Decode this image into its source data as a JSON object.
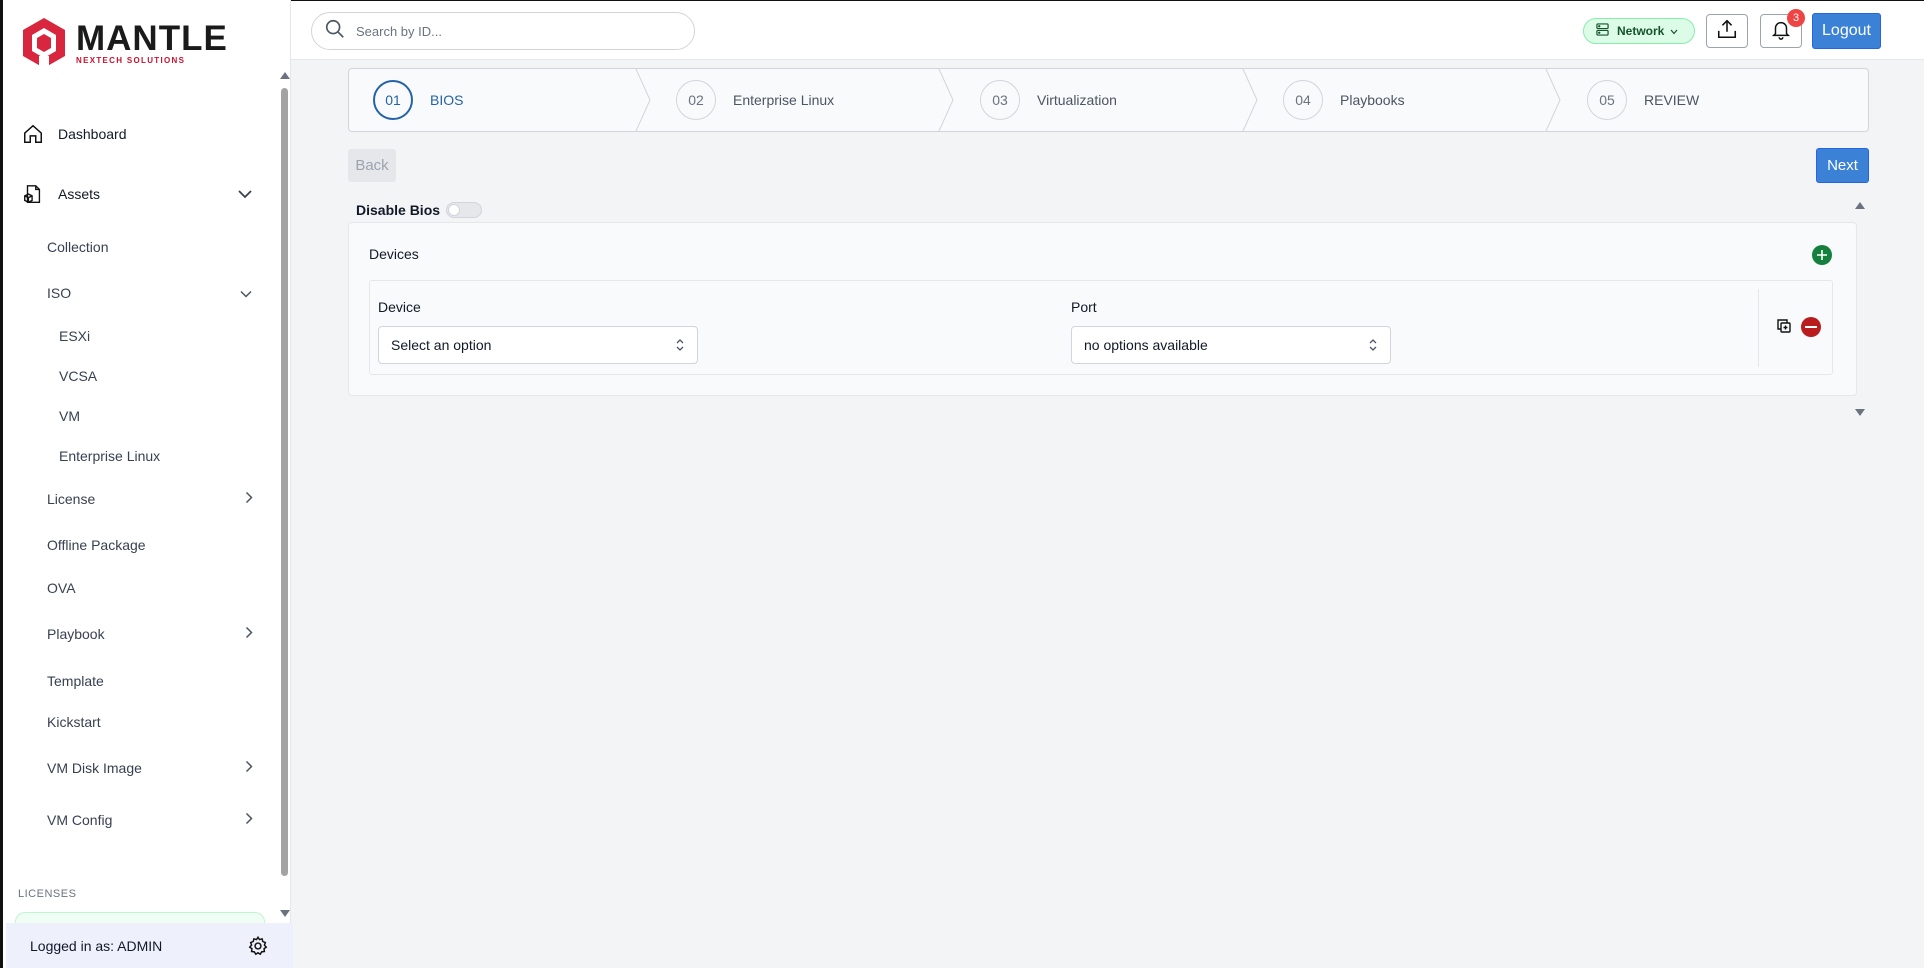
{
  "brand": {
    "title": "MANTLE",
    "subtitle": "NEXTECH SOLUTIONS",
    "red": "#d7263d"
  },
  "sidebar": {
    "dashboard": "Dashboard",
    "assets": "Assets",
    "collection": "Collection",
    "iso": "ISO",
    "iso_items": [
      "ESXi",
      "VCSA",
      "VM",
      "Enterprise Linux"
    ],
    "license": "License",
    "offline_package": "Offline Package",
    "ova": "OVA",
    "playbook": "Playbook",
    "template": "Template",
    "kickstart": "Kickstart",
    "vm_disk_image": "VM Disk Image",
    "vm_config": "VM Config",
    "licenses_label": "LICENSES",
    "logged_in": "Logged in as: ADMIN"
  },
  "header": {
    "search_placeholder": "Search by ID...",
    "network_label": "Network",
    "notifications_count": "3",
    "logout_label": "Logout"
  },
  "stepper": {
    "steps": [
      {
        "num": "01",
        "label": "BIOS",
        "active": true
      },
      {
        "num": "02",
        "label": "Enterprise Linux",
        "active": false
      },
      {
        "num": "03",
        "label": "Virtualization",
        "active": false
      },
      {
        "num": "04",
        "label": "Playbooks",
        "active": false
      },
      {
        "num": "05",
        "label": "REVIEW",
        "active": false
      }
    ]
  },
  "actions": {
    "back_label": "Back",
    "next_label": "Next"
  },
  "bios": {
    "disable_label": "Disable Bios",
    "devices_title": "Devices",
    "device_label": "Device",
    "device_value": "Select an option",
    "port_label": "Port",
    "port_value": "no options available"
  },
  "colors": {
    "primary": "#3b82d6",
    "active_step": "#2563a8",
    "add_green": "#15803d",
    "remove_red": "#b91c1c",
    "badge_red": "#ef4444"
  }
}
